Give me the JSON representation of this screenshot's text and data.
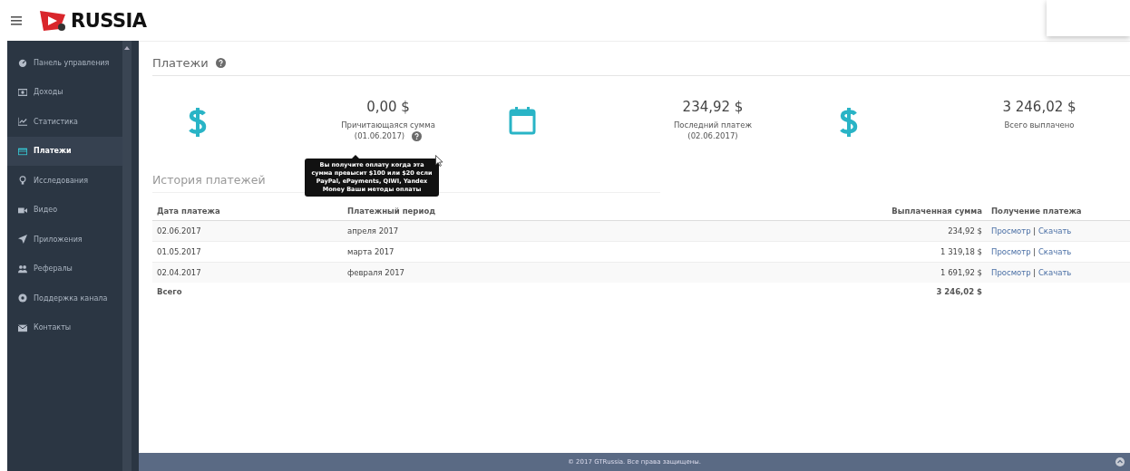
{
  "header": {
    "logo_text": "RUSSIA"
  },
  "sidebar": {
    "items": [
      {
        "label": "Панель управления",
        "selected": false
      },
      {
        "label": "Доходы",
        "selected": false
      },
      {
        "label": "Статистика",
        "selected": false
      },
      {
        "label": "Платежи",
        "selected": true
      },
      {
        "label": "Исследования",
        "selected": false
      },
      {
        "label": "Видео",
        "selected": false
      },
      {
        "label": "Приложения",
        "selected": false
      },
      {
        "label": "Рефералы",
        "selected": false
      },
      {
        "label": "Поддержка канала",
        "selected": false
      },
      {
        "label": "Контакты",
        "selected": false
      }
    ]
  },
  "page_title": "Платежи",
  "stats": [
    {
      "kind": "dollar",
      "value": "0,00 $",
      "label": "Причитающаяся сумма",
      "date": "(01.06.2017)",
      "help": true
    },
    {
      "kind": "calendar",
      "value": "234,92 $",
      "label": "Последний платеж",
      "date": "(02.06.2017)",
      "help": false
    },
    {
      "kind": "dollar",
      "value": "3 246,02 $",
      "label": "Всего выплачено",
      "help": false
    }
  ],
  "tooltip": "Вы получите оплату когда эта сумма превысит $100 или $20 если PayPal, ePayments, QIWI, Yandex Money Ваши методы оплаты",
  "history_title": "История платежей",
  "table": {
    "columns": [
      "Дата платежа",
      "Платежный период",
      "Выплаченная сумма",
      "Получение платежа"
    ],
    "rows": [
      {
        "date": "02.06.2017",
        "period": "апреля 2017",
        "amount": "234,92 $",
        "view": "Просмотр",
        "separator": "|",
        "download": "Скачать"
      },
      {
        "date": "01.05.2017",
        "period": "марта 2017",
        "amount": "1 319,18 $",
        "view": "Просмотр",
        "separator": "|",
        "download": "Скачать"
      },
      {
        "date": "02.04.2017",
        "period": "февраля 2017",
        "amount": "1 691,92 $",
        "view": "Просмотр",
        "separator": "|",
        "download": "Скачать"
      }
    ],
    "total": {
      "label": "Всего",
      "amount": "3 246,02 $"
    }
  },
  "footer": "© 2017 GTRussia. Все права защищены."
}
